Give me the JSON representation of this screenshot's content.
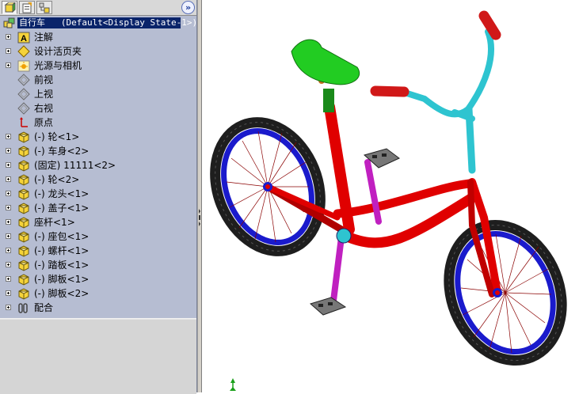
{
  "feature_tree": {
    "root": {
      "label": "自行车",
      "config": "(Default<Display State-1>)"
    },
    "items": [
      {
        "label": "注解",
        "icon": "annotations-icon",
        "expandable": true
      },
      {
        "label": "设计活页夹",
        "icon": "design-binder-icon",
        "expandable": true
      },
      {
        "label": "光源与相机",
        "icon": "lights-cameras-icon",
        "expandable": true
      },
      {
        "label": "前视",
        "icon": "plane-icon",
        "expandable": false
      },
      {
        "label": "上视",
        "icon": "plane-icon",
        "expandable": false
      },
      {
        "label": "右视",
        "icon": "plane-icon",
        "expandable": false
      },
      {
        "label": "原点",
        "icon": "origin-icon",
        "expandable": false
      },
      {
        "label": "(-) 轮<1>",
        "icon": "part-icon",
        "expandable": true
      },
      {
        "label": "(-) 车身<2>",
        "icon": "part-icon",
        "expandable": true
      },
      {
        "label": "(固定) 11111<2>",
        "icon": "part-icon",
        "expandable": true
      },
      {
        "label": "(-) 轮<2>",
        "icon": "part-icon",
        "expandable": true
      },
      {
        "label": "(-) 龙头<1>",
        "icon": "part-icon",
        "expandable": true
      },
      {
        "label": "(-) 盖子<1>",
        "icon": "part-icon",
        "expandable": true
      },
      {
        "label": "座杆<1>",
        "icon": "part-icon",
        "expandable": true
      },
      {
        "label": "(-) 座包<1>",
        "icon": "part-icon",
        "expandable": true
      },
      {
        "label": "(-) 螺杆<1>",
        "icon": "part-icon",
        "expandable": true
      },
      {
        "label": "(-) 踏板<1>",
        "icon": "part-icon",
        "expandable": true
      },
      {
        "label": "(-) 脚板<1>",
        "icon": "part-icon",
        "expandable": true
      },
      {
        "label": "(-) 脚板<2>",
        "icon": "part-icon",
        "expandable": true
      },
      {
        "label": "配合",
        "icon": "mates-icon",
        "expandable": true
      }
    ]
  },
  "tabs": [
    "feature-manager",
    "property-manager",
    "configuration-manager"
  ],
  "expand_button": "»",
  "colors": {
    "panel_bg": "#b6bdd2",
    "selection": "#0a246a",
    "frame_red": "#e00000",
    "seat_green": "#22cc22",
    "bar_cyan": "#2ec4d0",
    "rim_blue": "#1a1acc",
    "crank_purple": "#c020c0"
  }
}
